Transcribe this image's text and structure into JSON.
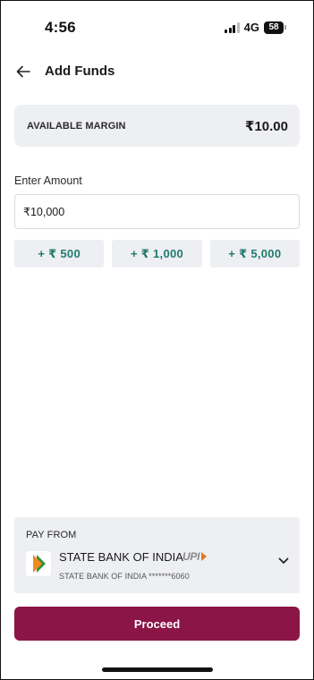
{
  "status_bar": {
    "time": "4:56",
    "network": "4G",
    "battery": "58"
  },
  "header": {
    "back_icon": "back-arrow-icon",
    "title": "Add Funds"
  },
  "margin_card": {
    "label": "AVAILABLE MARGIN",
    "value": "₹10.00"
  },
  "amount": {
    "label": "Enter Amount",
    "value": "₹10,000",
    "quick_add": [
      {
        "label": "+ ₹ 500"
      },
      {
        "label": "+ ₹ 1,000"
      },
      {
        "label": "+ ₹ 5,000"
      }
    ]
  },
  "pay_from": {
    "label": "PAY FROM",
    "bank_name": "STATE BANK OF INDIA",
    "upi_text": "UPI",
    "account": "STATE BANK OF INDIA *******6060",
    "chevron_icon": "chevron-down-icon"
  },
  "proceed_label": "Proceed",
  "colors": {
    "accent": "#8b1547",
    "quick_text": "#1f7a6c",
    "panel": "#eeeff3"
  }
}
